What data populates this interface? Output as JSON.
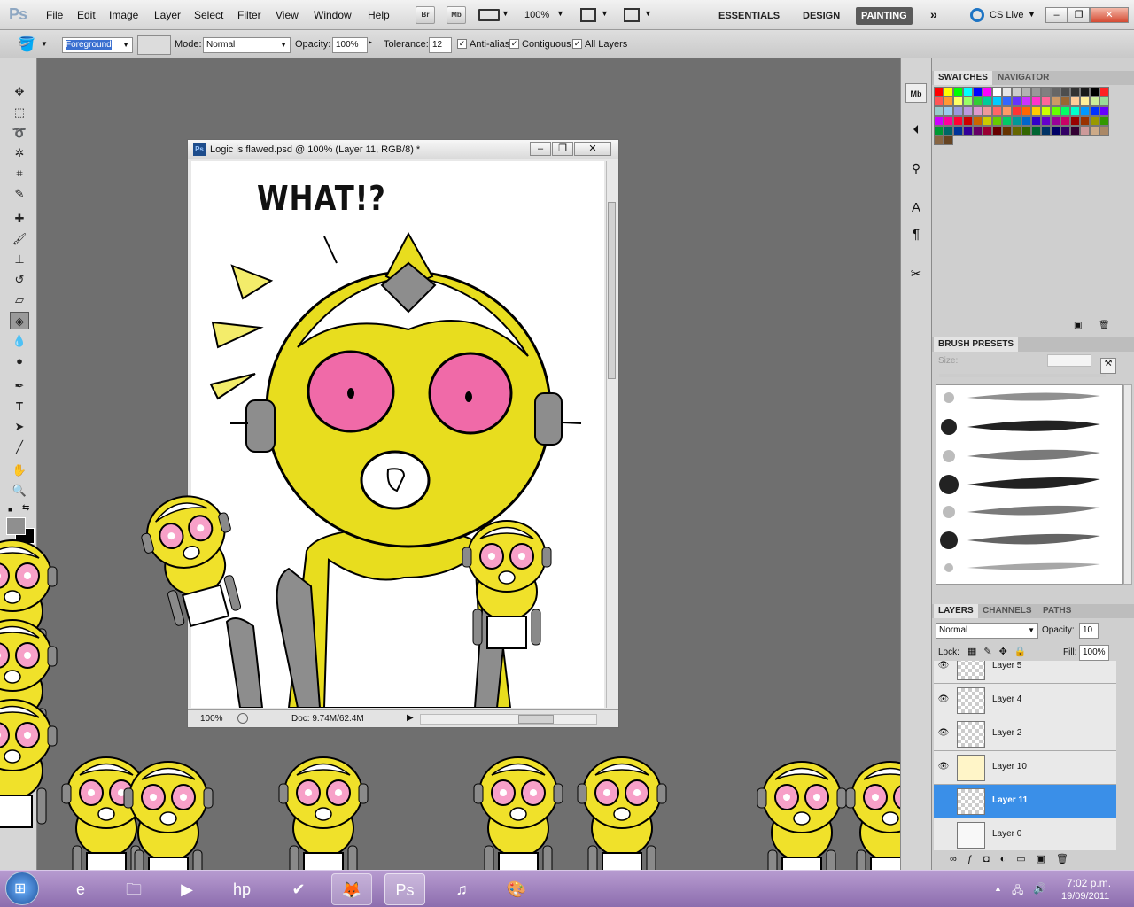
{
  "menubar": {
    "app_logo": "Ps",
    "menus": [
      "File",
      "Edit",
      "Image",
      "Layer",
      "Select",
      "Filter",
      "View",
      "Window",
      "Help"
    ],
    "bridge_label": "Br",
    "minibridge_label": "Mb",
    "zoom": "100%",
    "workspaces": [
      "ESSENTIALS",
      "DESIGN",
      "PAINTING"
    ],
    "active_workspace": "PAINTING",
    "cslive": "CS Live"
  },
  "options": {
    "fill_source": "Foreground",
    "mode_label": "Mode:",
    "mode_value": "Normal",
    "opacity_label": "Opacity:",
    "opacity_value": "100%",
    "tolerance_label": "Tolerance:",
    "tolerance_value": "12",
    "antialias_label": "Anti-alias",
    "contiguous_label": "Contiguous",
    "alllayers_label": "All Layers"
  },
  "document": {
    "title": "Logic is flawed.psd @ 100% (Layer 11, RGB/8) *",
    "canvas_text": "WHAT!?",
    "zoom": "100%",
    "doc_info": "Doc: 9.74M/62.4M"
  },
  "panels": {
    "swatches_tab": "SWATCHES",
    "navigator_tab": "NAVIGATOR",
    "brush_presets_tab": "BRUSH PRESETS",
    "size_label": "Size:",
    "layers_tab": "LAYERS",
    "channels_tab": "CHANNELS",
    "paths_tab": "PATHS",
    "blend_mode": "Normal",
    "opacity_label": "Opacity:",
    "opacity_value": "10",
    "lock_label": "Lock:",
    "fill_label": "Fill:",
    "fill_value": "100%",
    "layers": [
      {
        "name": "Layer 5"
      },
      {
        "name": "Layer 4"
      },
      {
        "name": "Layer 2"
      },
      {
        "name": "Layer 10"
      },
      {
        "name": "Layer 11"
      },
      {
        "name": "Layer 0"
      }
    ],
    "active_layer": "Layer 11",
    "swatch_colors": [
      "#ff0000",
      "#ffff00",
      "#00ff00",
      "#00ffff",
      "#0000ff",
      "#ff00ff",
      "#ffffff",
      "#e6e6e6",
      "#cccccc",
      "#b3b3b3",
      "#999999",
      "#808080",
      "#666666",
      "#4d4d4d",
      "#333333",
      "#1a1a1a",
      "#000000",
      "#ff2222",
      "#ff5555",
      "#ff9933",
      "#ffff66",
      "#99ff66",
      "#33cc33",
      "#00cc99",
      "#00ccff",
      "#3366ff",
      "#6633ff",
      "#cc33ff",
      "#ff33cc",
      "#ff6699",
      "#cc9966",
      "#996633",
      "#ffcc99",
      "#ffee99",
      "#ccee99",
      "#99dd99",
      "#99cccc",
      "#99ccee",
      "#9999dd",
      "#bb99dd",
      "#dd99cc",
      "#ee9999",
      "#ff6666",
      "#ff9966",
      "#ff3333",
      "#ff6600",
      "#ffcc00",
      "#ccff00",
      "#66ff00",
      "#00ff66",
      "#00ffcc",
      "#0099ff",
      "#0033ff",
      "#6600ff",
      "#cc00ff",
      "#ff0099",
      "#ff0033",
      "#cc0000",
      "#cc6600",
      "#cccc00",
      "#66cc00",
      "#00cc66",
      "#009999",
      "#0066cc",
      "#3300cc",
      "#6600cc",
      "#990099",
      "#cc0066",
      "#990000",
      "#993300",
      "#999900",
      "#339900",
      "#009933",
      "#006666",
      "#003399",
      "#330099",
      "#660066",
      "#990033",
      "#660000",
      "#663300",
      "#666600",
      "#336600",
      "#006633",
      "#003366",
      "#000066",
      "#330066",
      "#330033",
      "#cc9999",
      "#ccaa88",
      "#aa8866",
      "#886644",
      "#664422"
    ]
  },
  "taskbar": {
    "time": "7:02 p.m.",
    "date": "19/09/2011"
  },
  "colors": {
    "bot_yellow": "#f0e12a",
    "bot_pink": "#f06aa8",
    "bot_gray": "#8a8a8a",
    "selected_layer": "#3a8fe8"
  }
}
